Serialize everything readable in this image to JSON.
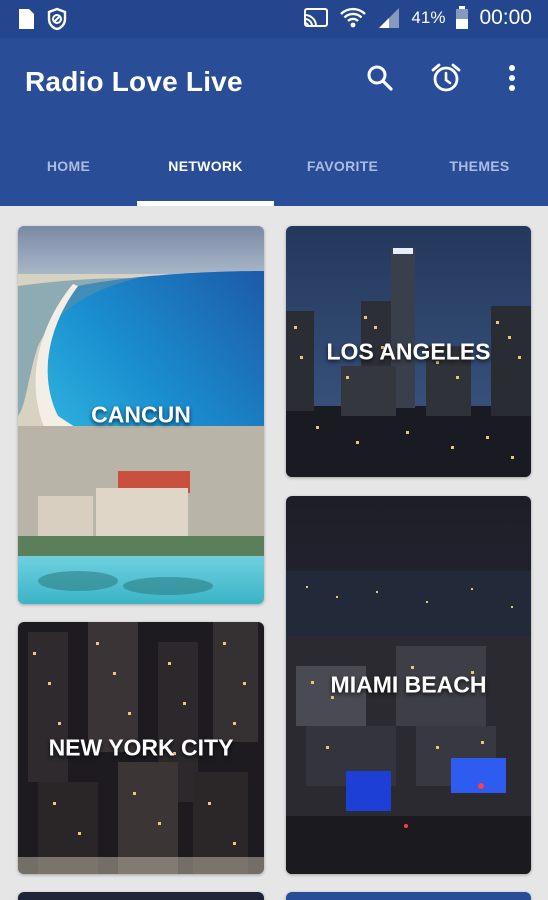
{
  "status_bar": {
    "battery": "41%",
    "time": "00:00",
    "icons": [
      "sim-icon",
      "shield-icon",
      "cast-icon",
      "wifi-icon",
      "signal-icon",
      "battery-icon"
    ]
  },
  "app_bar": {
    "title": "Radio Love Live",
    "actions": [
      "search-icon",
      "alarm-icon",
      "more-vert-icon"
    ]
  },
  "tabs": [
    {
      "label": "HOME",
      "active": false
    },
    {
      "label": "NETWORK",
      "active": true
    },
    {
      "label": "FAVORITE",
      "active": false
    },
    {
      "label": "THEMES",
      "active": false
    }
  ],
  "cities": [
    {
      "name": "CANCUN"
    },
    {
      "name": "LOS ANGELES"
    },
    {
      "name": "MIAMI BEACH"
    },
    {
      "name": "NEW YORK CITY"
    }
  ],
  "colors": {
    "primary": "#2a4d98",
    "status_bar": "#23468f",
    "background": "#e6e6e6",
    "tab_active": "#ffffff",
    "tab_inactive": "#aebbe0"
  }
}
